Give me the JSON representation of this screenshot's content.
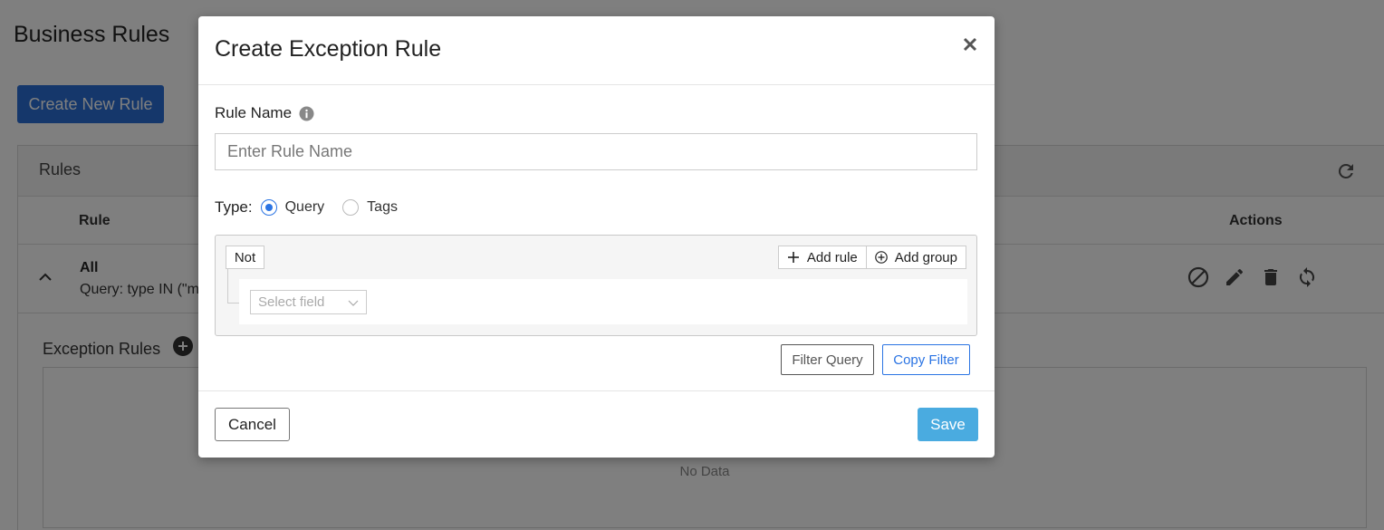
{
  "background": {
    "page_title": "Business Rules",
    "create_button": "Create New Rule",
    "rules_panel": {
      "title": "Rules",
      "columns": {
        "rule": "Rule",
        "actions": "Actions"
      },
      "row": {
        "name": "All",
        "query": "Query: type IN (\"m"
      }
    },
    "exception_rules": {
      "title": "Exception Rules",
      "empty_text": "No Data"
    }
  },
  "modal": {
    "title": "Create Exception Rule",
    "rule_name_label": "Rule Name",
    "rule_name_placeholder": "Enter Rule Name",
    "type_label": "Type:",
    "type_options": [
      {
        "label": "Query",
        "checked": true
      },
      {
        "label": "Tags",
        "checked": false
      }
    ],
    "query_builder": {
      "not_label": "Not",
      "add_rule_label": "Add rule",
      "add_group_label": "Add group",
      "select_field_placeholder": "Select field"
    },
    "filter_query_label": "Filter Query",
    "copy_filter_label": "Copy Filter",
    "cancel_label": "Cancel",
    "save_label": "Save"
  },
  "colors": {
    "primary": "#2b6fd6",
    "save": "#4aabe0",
    "link_blue": "#2b74e3",
    "overlay": "rgba(0,0,0,0.5)"
  }
}
